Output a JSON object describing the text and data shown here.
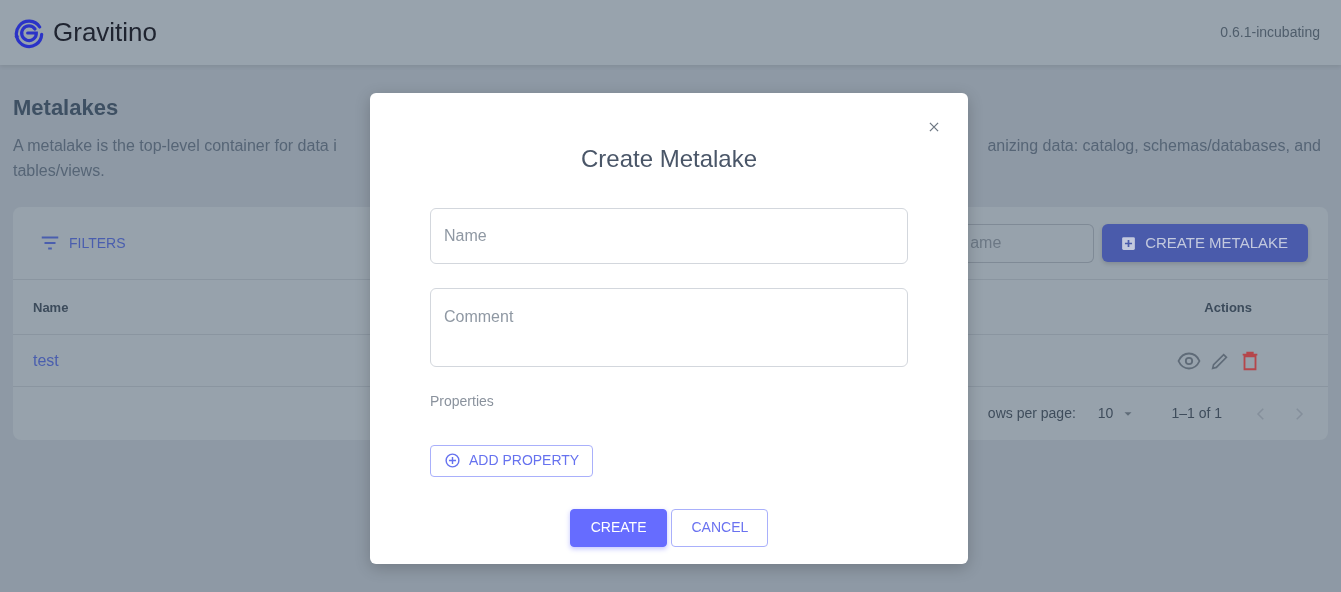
{
  "header": {
    "logo_text": "Gravitino",
    "version": "0.6.1-incubating"
  },
  "page": {
    "title": "Metalakes",
    "description_left": "A metalake is the top-level container for data i",
    "description_right": "anizing data: catalog, schemas/databases, and",
    "description_line2": "tables/views."
  },
  "toolbar": {
    "filters_label": "FILTERS",
    "search": {
      "placeholder": "ame"
    },
    "create_button": "CREATE METALAKE"
  },
  "table": {
    "columns": [
      "Name",
      "Actions"
    ],
    "rows": [
      {
        "name": "test"
      }
    ]
  },
  "pagination": {
    "rows_per_page_label": "ows per page:",
    "rows_per_page": "10",
    "range": "1–1 of 1",
    "prev_disabled": true,
    "next_disabled": true
  },
  "dialog": {
    "title": "Create Metalake",
    "fields": [
      {
        "placeholder": "Name",
        "kind": "line"
      },
      {
        "placeholder": "Comment",
        "kind": "multiline"
      }
    ],
    "properties_label": "Properties",
    "add_property_button": "ADD PROPERTY",
    "buttons": [
      {
        "label": "CREATE",
        "kind": "primary"
      },
      {
        "label": "CANCEL",
        "kind": "outline"
      }
    ]
  }
}
